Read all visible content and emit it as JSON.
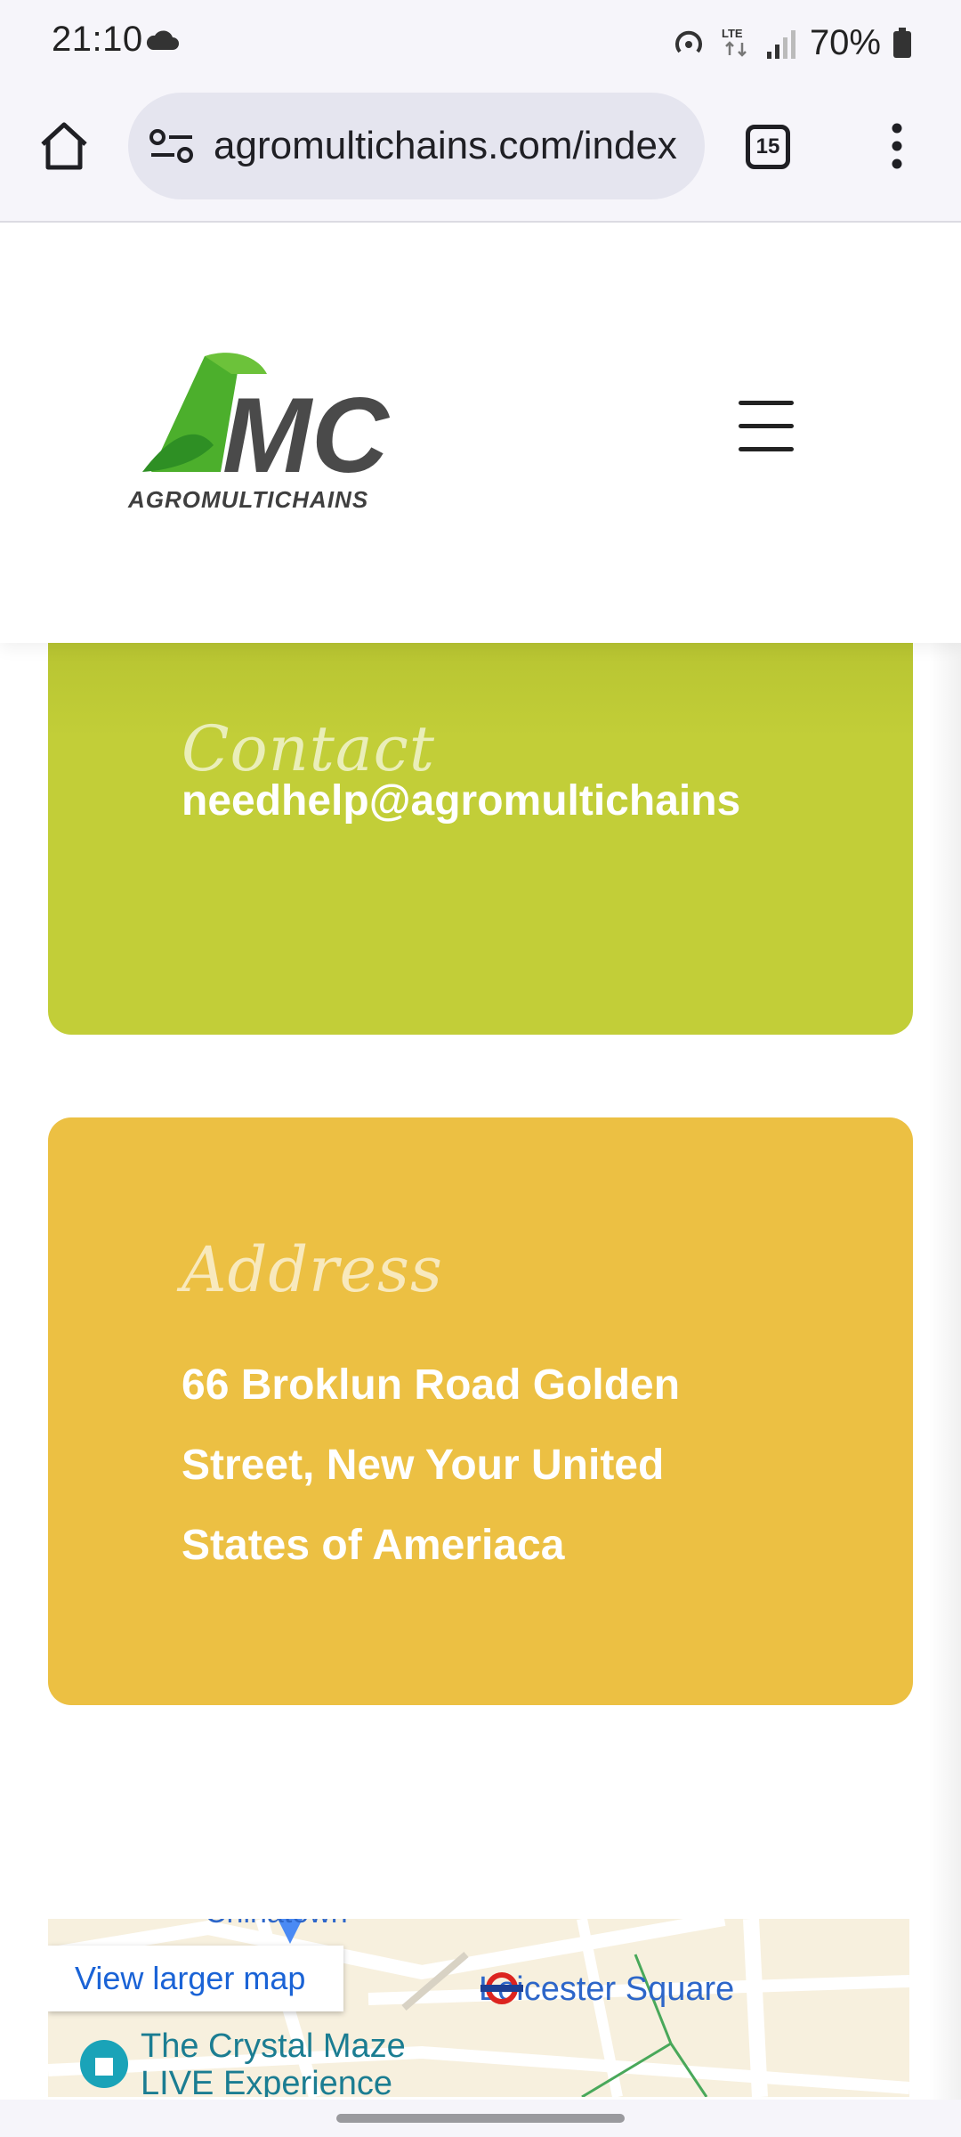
{
  "status_bar": {
    "time": "21:10",
    "network": "LTE",
    "battery": "70%"
  },
  "browser": {
    "url": "agromultichains.com/index",
    "tab_count": "15"
  },
  "site": {
    "logo_text": "AMC",
    "logo_subtitle": "AGROMULTICHAINS"
  },
  "contact": {
    "title": "Contact",
    "email": "needhelp@agromultichains"
  },
  "address": {
    "title": "Address",
    "lines": [
      "66 Broklun Road Golden",
      "Street, New Your United",
      "States of Ameriaca"
    ]
  },
  "map": {
    "link_label": "View larger map",
    "place_1": "Leicester Square",
    "place_2_line1": "The Crystal Maze",
    "place_2_line2": "LIVE Experience",
    "place_top": "Chinatown"
  },
  "colors": {
    "contact_card": "#c2ce38",
    "address_card": "#ecc043",
    "logo_green": "#4caf2c",
    "logo_gray": "#4a4a4a"
  }
}
